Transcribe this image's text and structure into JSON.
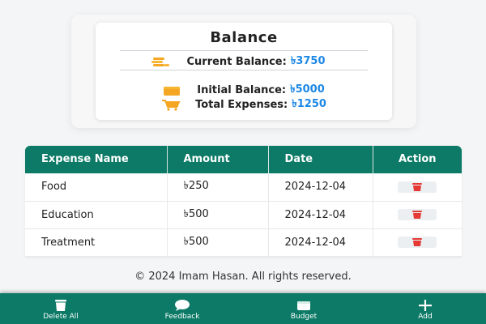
{
  "balance": {
    "title": "Balance",
    "current_label": "Current Balance:",
    "current_value": "৳3750",
    "initial_label": "Initial Balance:",
    "initial_value": "৳5000",
    "expenses_label": "Total Expenses:",
    "expenses_value": "৳1250",
    "icons": [
      "coins-icon",
      "wallet-icon",
      "cart-icon"
    ]
  },
  "table": {
    "headers": [
      "Expense Name",
      "Amount",
      "Date",
      "Action"
    ],
    "rows": [
      {
        "name": "Food",
        "amount": "৳250",
        "date": "2024-12-04"
      },
      {
        "name": "Education",
        "amount": "৳500",
        "date": "2024-12-04"
      },
      {
        "name": "Treatment",
        "amount": "৳500",
        "date": "2024-12-04"
      }
    ]
  },
  "footer": {
    "copyright": "© 2024 Imam Hasan. All rights reserved."
  },
  "nav": {
    "items": [
      {
        "label": "Delete All",
        "icon": "trash-icon"
      },
      {
        "label": "Feedback",
        "icon": "chat-icon"
      },
      {
        "label": "Budget",
        "icon": "budget-icon"
      },
      {
        "label": "Add",
        "icon": "plus-icon"
      }
    ]
  },
  "colors": {
    "primary": "#0c7a66",
    "accent": "#1e88e5",
    "icon_gold": "#f5a623",
    "delete_red": "#e53935"
  }
}
